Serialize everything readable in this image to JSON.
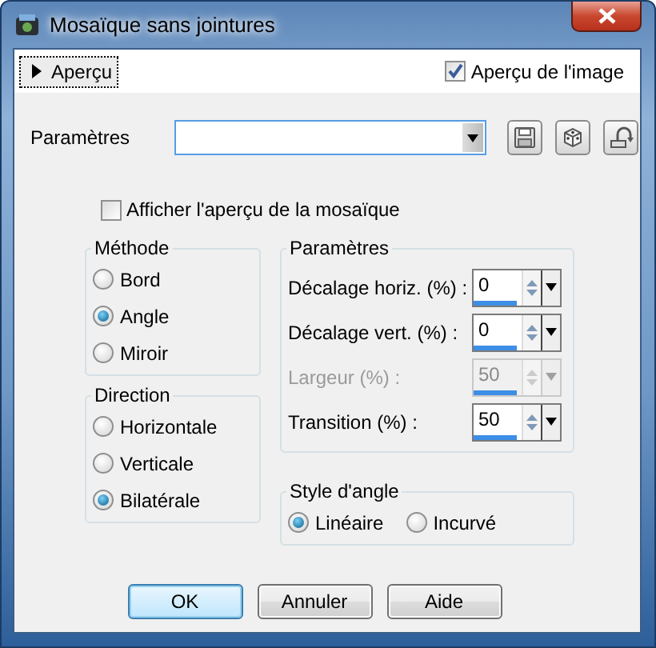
{
  "window": {
    "title": "Mosaïque sans jointures"
  },
  "preview_toggle": {
    "label": "Aperçu",
    "expanded": false
  },
  "image_preview": {
    "label": "Aperçu de l'image",
    "checked": true
  },
  "presets": {
    "label": "Paramètres"
  },
  "show_tile_preview": {
    "label": "Afficher l'aperçu de la mosaïque",
    "checked": false
  },
  "method": {
    "title": "Méthode",
    "options": [
      {
        "label": "Bord",
        "selected": false
      },
      {
        "label": "Angle",
        "selected": true
      },
      {
        "label": "Miroir",
        "selected": false
      }
    ]
  },
  "direction": {
    "title": "Direction",
    "options": [
      {
        "label": "Horizontale",
        "selected": false
      },
      {
        "label": "Verticale",
        "selected": false
      },
      {
        "label": "Bilatérale",
        "selected": true
      }
    ]
  },
  "parameters": {
    "title": "Paramètres",
    "fields": [
      {
        "label": "Décalage horiz. (%) :",
        "value": "0",
        "disabled": false
      },
      {
        "label": "Décalage vert. (%) :",
        "value": "0",
        "disabled": false
      },
      {
        "label": "Largeur (%) :",
        "value": "50",
        "disabled": true
      },
      {
        "label": "Transition (%) :",
        "value": "50",
        "disabled": false
      }
    ]
  },
  "angle_style": {
    "title": "Style d'angle",
    "options": [
      {
        "label": "Linéaire",
        "selected": true
      },
      {
        "label": "Incurvé",
        "selected": false
      }
    ]
  },
  "buttons": [
    {
      "label": "OK",
      "default": true
    },
    {
      "label": "Annuler",
      "default": false
    },
    {
      "label": "Aide",
      "default": false
    }
  ]
}
